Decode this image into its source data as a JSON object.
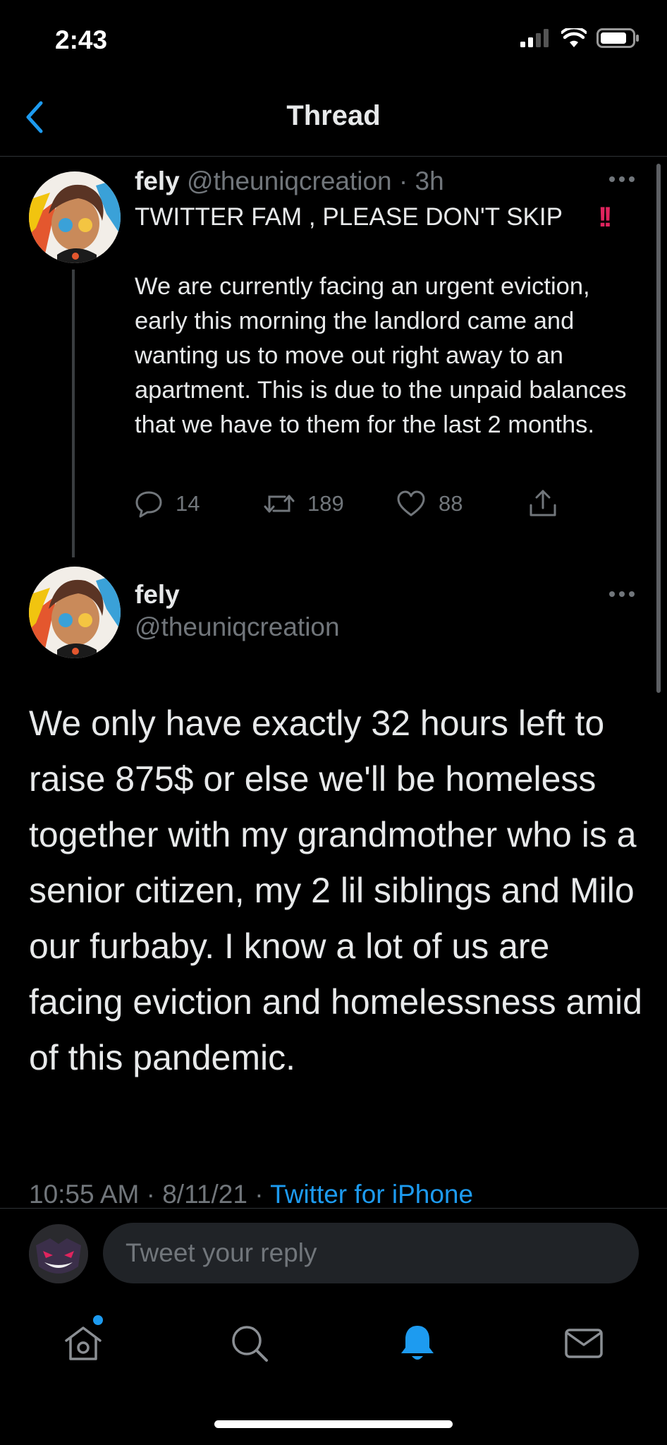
{
  "status_bar": {
    "time": "2:43"
  },
  "nav": {
    "title": "Thread"
  },
  "tweet1": {
    "name": "fely",
    "handle": "@theuniqcreation",
    "separator": "·",
    "age": "3h",
    "line1": "TWITTER FAM , PLEASE DON'T SKIP",
    "emoji": "!!",
    "body": "We are currently facing an urgent eviction, early this morning the landlord came and wanting us to move out right away to an apartment. This is due to the unpaid balances that we have to them for the last 2 months.",
    "replies": "14",
    "retweets": "189",
    "likes": "88"
  },
  "tweet2": {
    "name": "fely",
    "handle": "@theuniqcreation",
    "body": "We only have exactly 32 hours left to raise 875$ or else we'll be homeless together with my grandmother who is a senior citizen, my 2 lil siblings and  Milo our furbaby. I know a lot of us are facing eviction and homelessness amid of this pandemic.",
    "time": "10:55 AM",
    "date": "8/11/21",
    "separator": "·",
    "source": "Twitter for iPhone"
  },
  "reply": {
    "placeholder": "Tweet your reply"
  },
  "colors": {
    "accent": "#1d9bf0",
    "background": "#000000",
    "dim_text": "#71767b",
    "alert": "#e0245e"
  },
  "icons": [
    "back-chevron-icon",
    "more-icon",
    "reply-icon",
    "retweet-icon",
    "like-icon",
    "share-icon",
    "home-icon",
    "search-icon",
    "notifications-icon",
    "messages-icon"
  ]
}
